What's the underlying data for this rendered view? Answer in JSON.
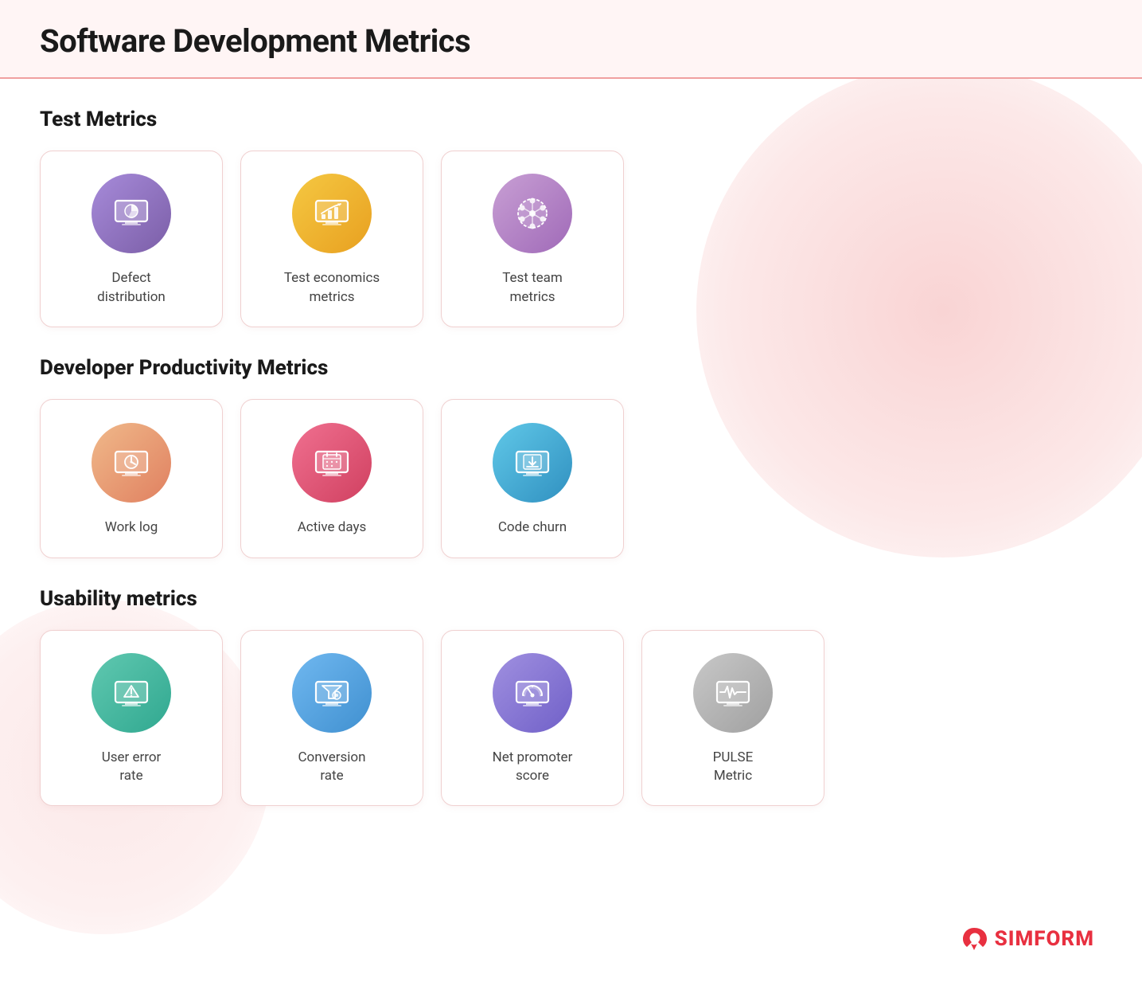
{
  "header": {
    "title": "Software Development Metrics"
  },
  "sections": [
    {
      "id": "test-metrics",
      "title": "Test Metrics",
      "cards": [
        {
          "id": "defect-distribution",
          "label": "Defect\ndistribution",
          "icon": "monitor-chart",
          "iconClass": "ic-purple"
        },
        {
          "id": "test-economics",
          "label": "Test economics\nmetrics",
          "icon": "chart-bar",
          "iconClass": "ic-gold"
        },
        {
          "id": "test-team-metrics",
          "label": "Test team\nmetrics",
          "icon": "team-network",
          "iconClass": "ic-mauve"
        }
      ]
    },
    {
      "id": "dev-productivity",
      "title": "Developer Productivity Metrics",
      "cards": [
        {
          "id": "work-log",
          "label": "Work log",
          "icon": "monitor-clock",
          "iconClass": "ic-peach"
        },
        {
          "id": "active-days",
          "label": "Active days",
          "icon": "monitor-calendar",
          "iconClass": "ic-pink"
        },
        {
          "id": "code-churn",
          "label": "Code churn",
          "icon": "monitor-code",
          "iconClass": "ic-skyblue"
        }
      ]
    },
    {
      "id": "usability-metrics",
      "title": "Usability metrics",
      "cards": [
        {
          "id": "user-error-rate",
          "label": "User error\nrate",
          "icon": "monitor-alert",
          "iconClass": "ic-teal"
        },
        {
          "id": "conversion-rate",
          "label": "Conversion\nrate",
          "icon": "monitor-funnel",
          "iconClass": "ic-blue"
        },
        {
          "id": "net-promoter-score",
          "label": "Net promoter\nscore",
          "icon": "monitor-gauge",
          "iconClass": "ic-lavender"
        },
        {
          "id": "pulse-metric",
          "label": "PULSE\nMetric",
          "icon": "monitor-pulse",
          "iconClass": "ic-gray"
        }
      ]
    }
  ],
  "logo": {
    "text": "SIMFORM"
  }
}
